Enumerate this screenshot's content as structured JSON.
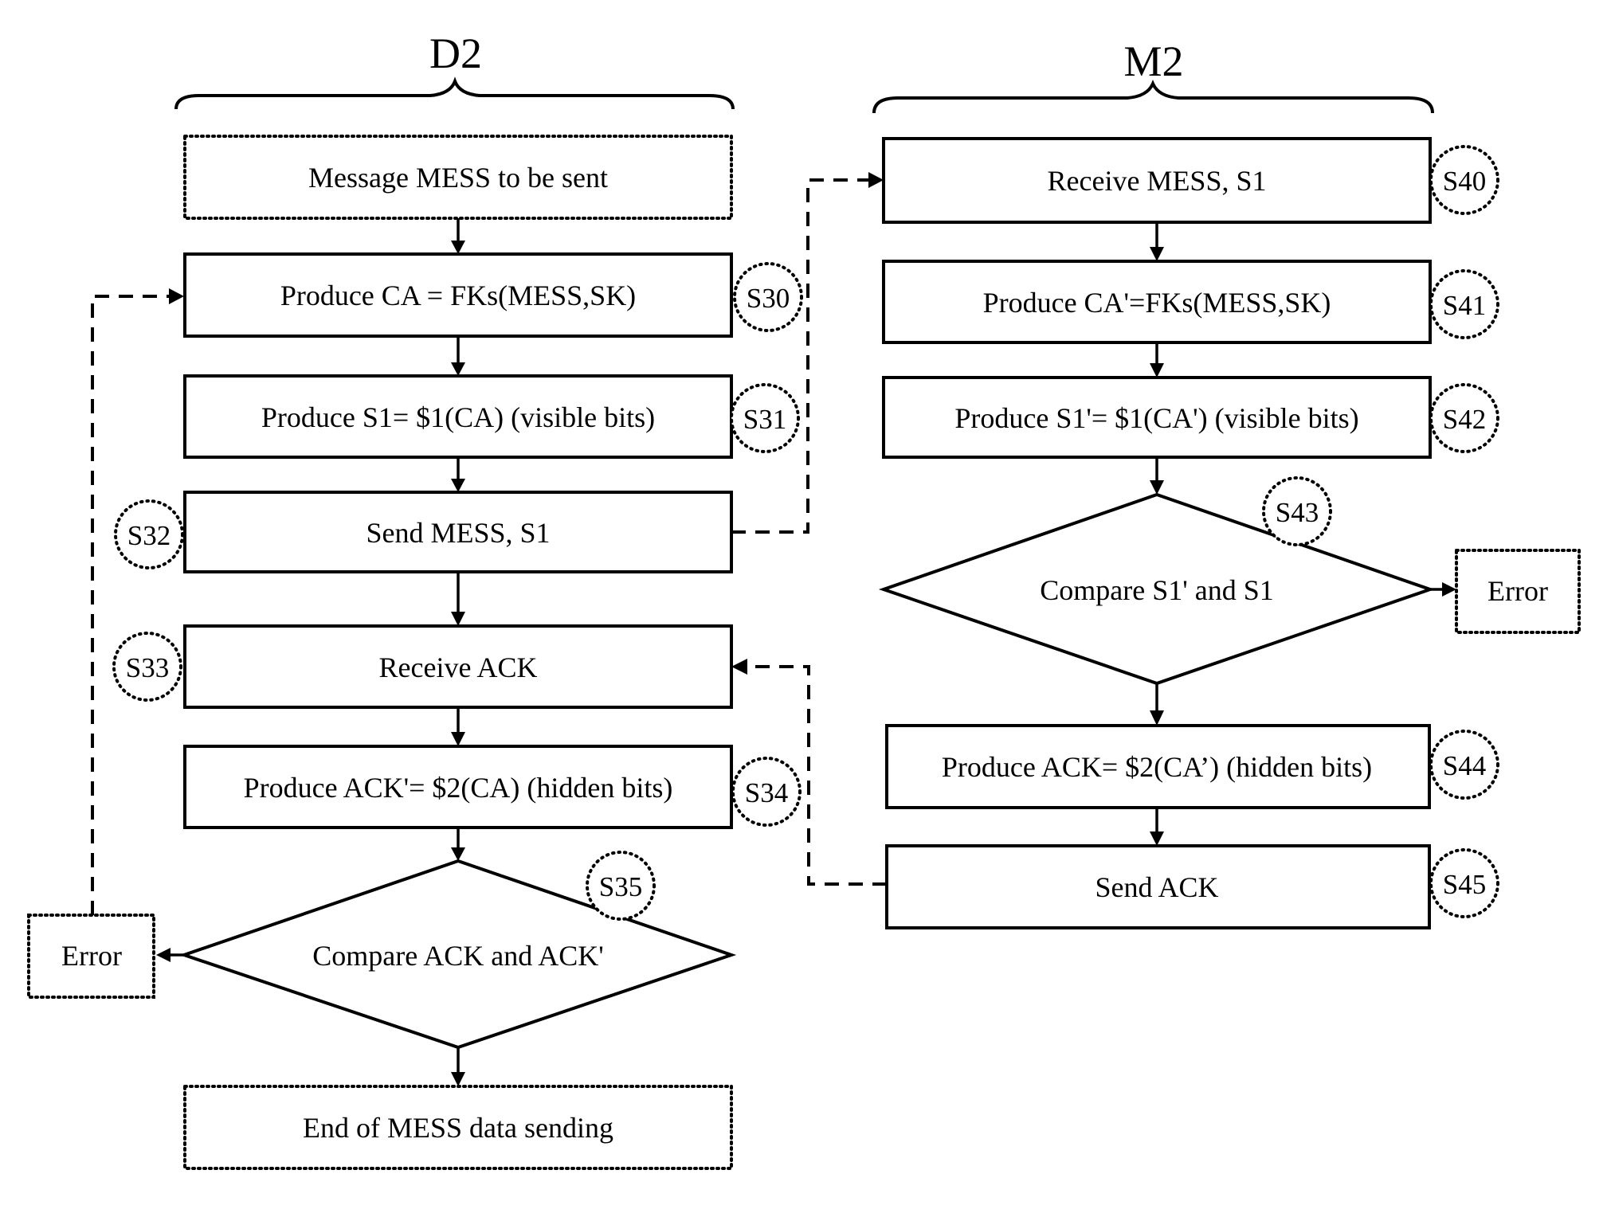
{
  "lanes": {
    "left": "D2",
    "right": "M2"
  },
  "left_flow": {
    "start": "Message MESS to be sent",
    "s30": {
      "step": "S30",
      "text": "Produce CA = FKs(MESS,SK)"
    },
    "s31": {
      "step": "S31",
      "text": "Produce S1= $1(CA) (visible bits)"
    },
    "s32": {
      "step": "S32",
      "text": "Send MESS, S1"
    },
    "s33": {
      "step": "S33",
      "text": "Receive ACK"
    },
    "s34": {
      "step": "S34",
      "text": "Produce ACK'= $2(CA) (hidden bits)"
    },
    "s35": {
      "step": "S35",
      "text": "Compare ACK and ACK'"
    },
    "error": "Error",
    "end": "End of MESS data sending"
  },
  "right_flow": {
    "s40": {
      "step": "S40",
      "text": "Receive  MESS, S1"
    },
    "s41": {
      "step": "S41",
      "text": "Produce CA'=FKs(MESS,SK)"
    },
    "s42": {
      "step": "S42",
      "text": "Produce S1'= $1(CA') (visible bits)"
    },
    "s43": {
      "step": "S43",
      "text": "Compare S1' and S1"
    },
    "s44": {
      "step": "S44",
      "text": "Produce ACK= $2(CA’) (hidden bits)"
    },
    "s45": {
      "step": "S45",
      "text": "Send ACK"
    },
    "error": "Error"
  }
}
